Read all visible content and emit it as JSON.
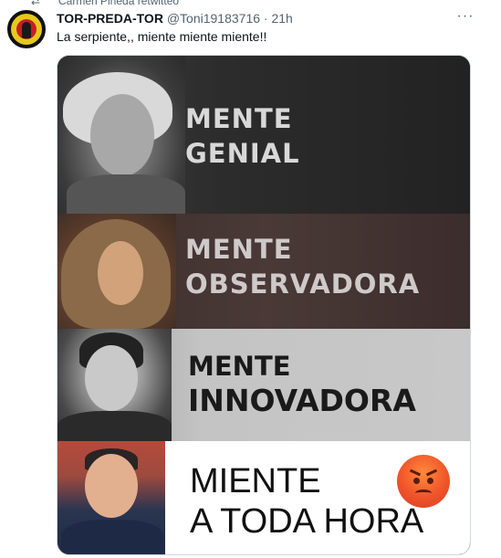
{
  "retweet": {
    "text": "Carmen Pineda retwitteó"
  },
  "tweet": {
    "display_name": "TOR-PREDA-TOR",
    "handle": "@Toni19183716",
    "separator": "·",
    "time": "21h",
    "more_icon": "···",
    "text": "La serpiente,, miente miente miente!!"
  },
  "media": {
    "panels": [
      {
        "line1": "MENTE",
        "line2": "GENIAL"
      },
      {
        "line1": "MENTE",
        "line2": "OBSERVADORA"
      },
      {
        "line1": "MENTE",
        "line2": "INNOVADORA"
      },
      {
        "line1": "MIENTE",
        "line2": "A TODA HORA"
      }
    ],
    "emoji": "angry-face-icon"
  }
}
